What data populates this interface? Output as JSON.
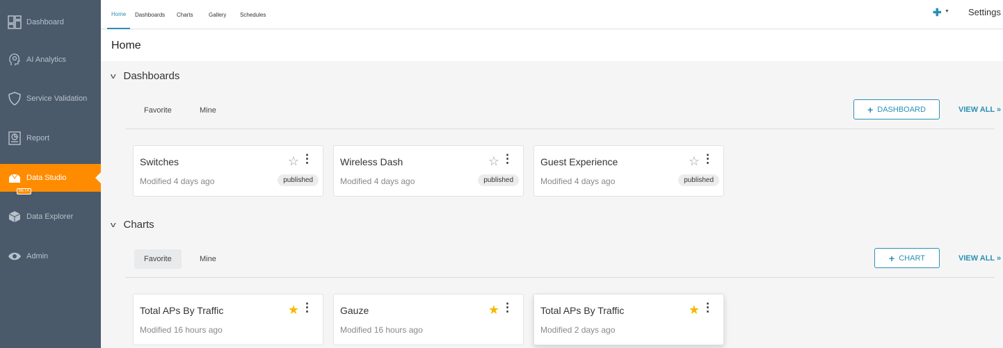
{
  "sidebar": {
    "items": [
      {
        "label": "Dashboard",
        "icon": "dashboard-icon"
      },
      {
        "label": "AI Analytics",
        "icon": "ai-analytics-icon"
      },
      {
        "label": "Service Validation",
        "icon": "shield-icon"
      },
      {
        "label": "Report",
        "icon": "report-icon"
      },
      {
        "label": "Data Studio",
        "icon": "data-studio-icon",
        "badge": "BETA",
        "active": true
      },
      {
        "label": "Data Explorer",
        "icon": "cube-icon"
      },
      {
        "label": "Admin",
        "icon": "eye-icon"
      }
    ]
  },
  "topbar": {
    "tabs": [
      "Home",
      "Dashboards",
      "Charts",
      "Gallery",
      "Schedules"
    ],
    "active_tab": "Home",
    "add_icon": "plus-icon",
    "settings_label": "Settings"
  },
  "page": {
    "title": "Home"
  },
  "dashboards": {
    "title": "Dashboards",
    "subtabs": [
      "Favorite",
      "Mine"
    ],
    "add_button": "DASHBOARD",
    "view_all": "VIEW ALL »",
    "cards": [
      {
        "title": "Switches",
        "modified": "Modified 4 days ago",
        "badge": "published",
        "starred": false
      },
      {
        "title": "Wireless Dash",
        "modified": "Modified 4 days ago",
        "badge": "published",
        "starred": false
      },
      {
        "title": "Guest Experience",
        "modified": "Modified 4 days ago",
        "badge": "published",
        "starred": false
      }
    ]
  },
  "charts": {
    "title": "Charts",
    "subtabs": [
      "Favorite",
      "Mine"
    ],
    "add_button": "CHART",
    "view_all": "VIEW ALL »",
    "cards": [
      {
        "title": "Total APs By Traffic",
        "modified": "Modified 16 hours ago",
        "starred": true
      },
      {
        "title": "Gauze",
        "modified": "Modified 16 hours ago",
        "starred": true
      },
      {
        "title": "Total APs By Traffic",
        "modified": "Modified 2 days ago",
        "starred": true
      }
    ]
  },
  "colors": {
    "accent": "#2a8fb5",
    "sidebar": "#4a5a6a",
    "active": "#ff8c00",
    "star": "#f5b800"
  }
}
